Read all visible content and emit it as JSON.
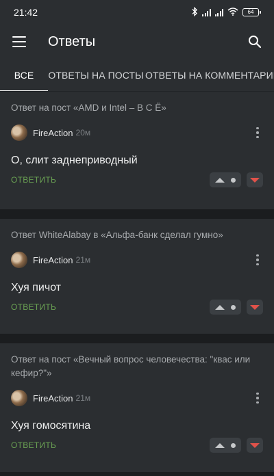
{
  "status": {
    "time": "21:42",
    "battery": "64"
  },
  "app": {
    "title": "Ответы"
  },
  "tabs": [
    {
      "label": "ВСЕ",
      "active": true
    },
    {
      "label": "ОТВЕТЫ НА ПОСТЫ",
      "active": false
    },
    {
      "label": "ОТВЕТЫ НА КОММЕНТАРИИ",
      "active": false
    }
  ],
  "reply_label": "ОТВЕТИТЬ",
  "cards": [
    {
      "header": "Ответ на пост «AMD и Intel – В С Ё»",
      "author": "FireAction",
      "time": "20м",
      "text": "О, слит заднеприводный"
    },
    {
      "header": "Ответ WhiteAlabay в «Альфа-банк сделал гумно»",
      "author": "FireAction",
      "time": "21м",
      "text": "Хуя пичот"
    },
    {
      "header": "Ответ на пост «Вечный вопрос человечества: \"квас или кефир?\"»",
      "author": "FireAction",
      "time": "21м",
      "text": "Хуя гомосятина"
    }
  ],
  "colors": {
    "background": "#1b1d1f",
    "card": "#2b2e31",
    "reply_green": "#6aa153",
    "downvote_red": "#e0524a"
  },
  "icons": {
    "menu": "hamburger-menu-icon",
    "search": "search-icon",
    "more": "more-vertical-icon",
    "upvote": "arrow-up-icon",
    "downvote": "arrow-down-icon"
  }
}
